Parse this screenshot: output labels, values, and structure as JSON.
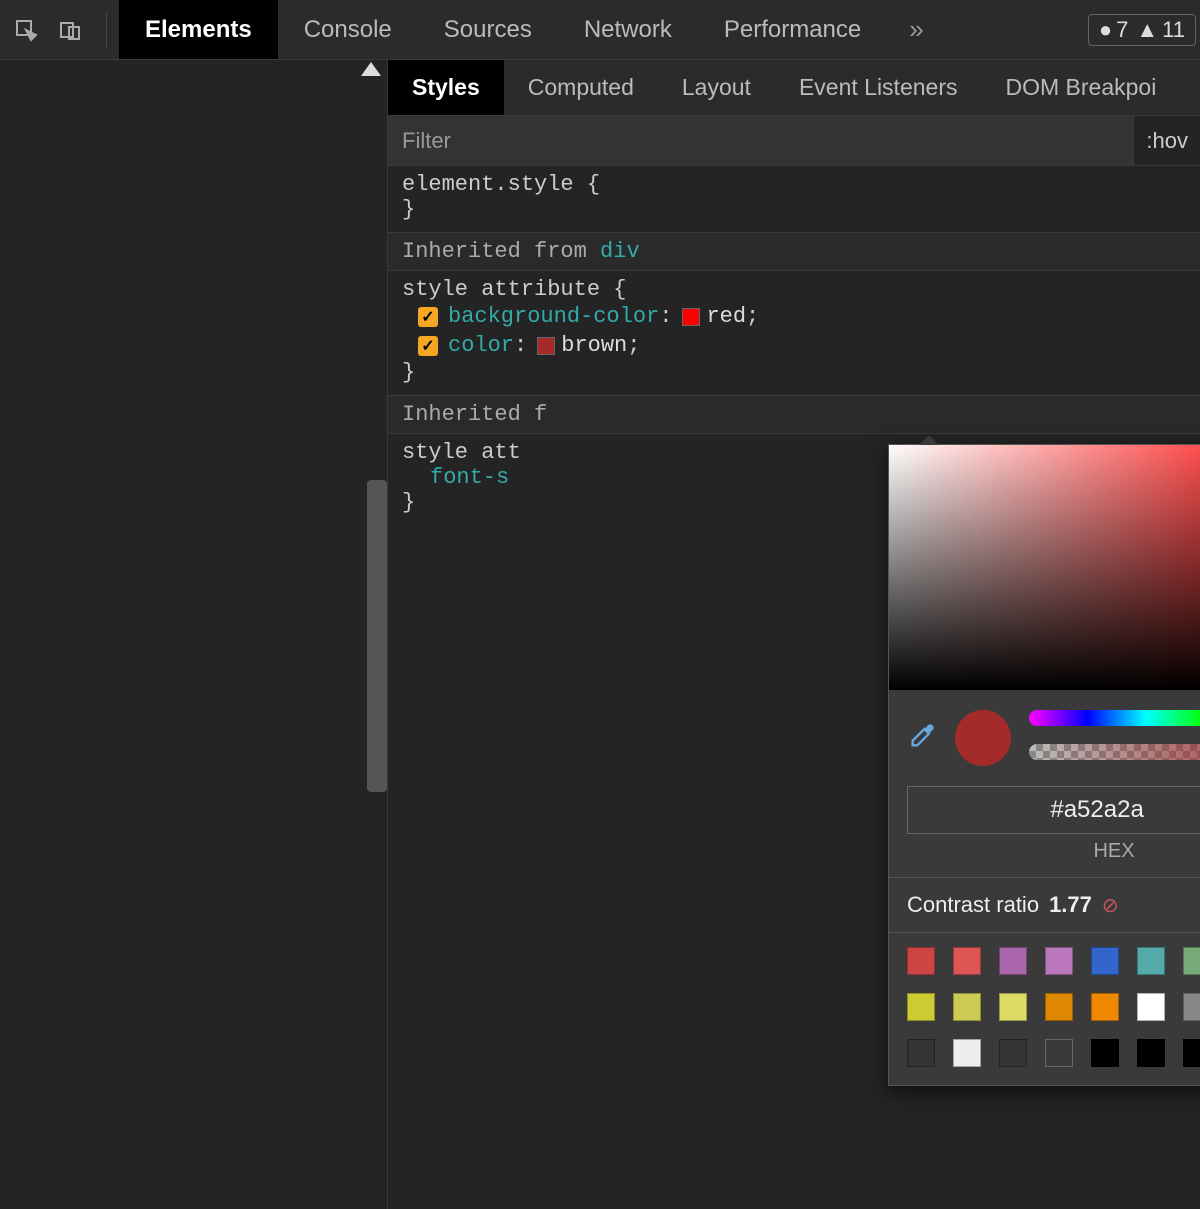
{
  "toolbar": {
    "tabs": [
      "Elements",
      "Console",
      "Sources",
      "Network",
      "Performance"
    ],
    "active_tab_index": 0,
    "errors_count": "7",
    "warnings_count": "11"
  },
  "sub_tabs": {
    "items": [
      "Styles",
      "Computed",
      "Layout",
      "Event Listeners",
      "DOM Breakpoi"
    ],
    "active_index": 0
  },
  "filter": {
    "placeholder": "Filter",
    "hov_label": ":hov"
  },
  "styles": {
    "element_style": {
      "selector": "element.style",
      "open": "{",
      "close": "}"
    },
    "inherited_label": "Inherited from",
    "inherited_link": "div",
    "style_attribute": {
      "selector": "style attribute",
      "open": "{",
      "close": "}",
      "props": [
        {
          "name": "background-color",
          "value": "red",
          "swatch": "#ff0000"
        },
        {
          "name": "color",
          "value": "brown",
          "swatch": "#a52a2a"
        }
      ]
    },
    "inherited2_prefix": "Inherited f",
    "style_attr2_selector_prefix": "style att",
    "font_prop_prefix": "font-s"
  },
  "box_model": {
    "dash": "-"
  },
  "color_picker": {
    "hex_value": "#a52a2a",
    "hex_label": "HEX",
    "preview_color": "#a52a2a",
    "contrast_label": "Contrast ratio",
    "contrast_value": "1.77",
    "palette": [
      [
        "#c44",
        "#d55",
        "#a6a",
        "#b7b",
        "#36c",
        "#5aa",
        "#7a7",
        "#8b3"
      ],
      [
        "#cc3",
        "#cc5",
        "#dd6",
        "#d80",
        "#e80",
        "#fff",
        "#888",
        "#444"
      ],
      [
        "#333",
        "#eee",
        "#333",
        "",
        "#000",
        "#000",
        "#000",
        "#ccc"
      ]
    ]
  }
}
